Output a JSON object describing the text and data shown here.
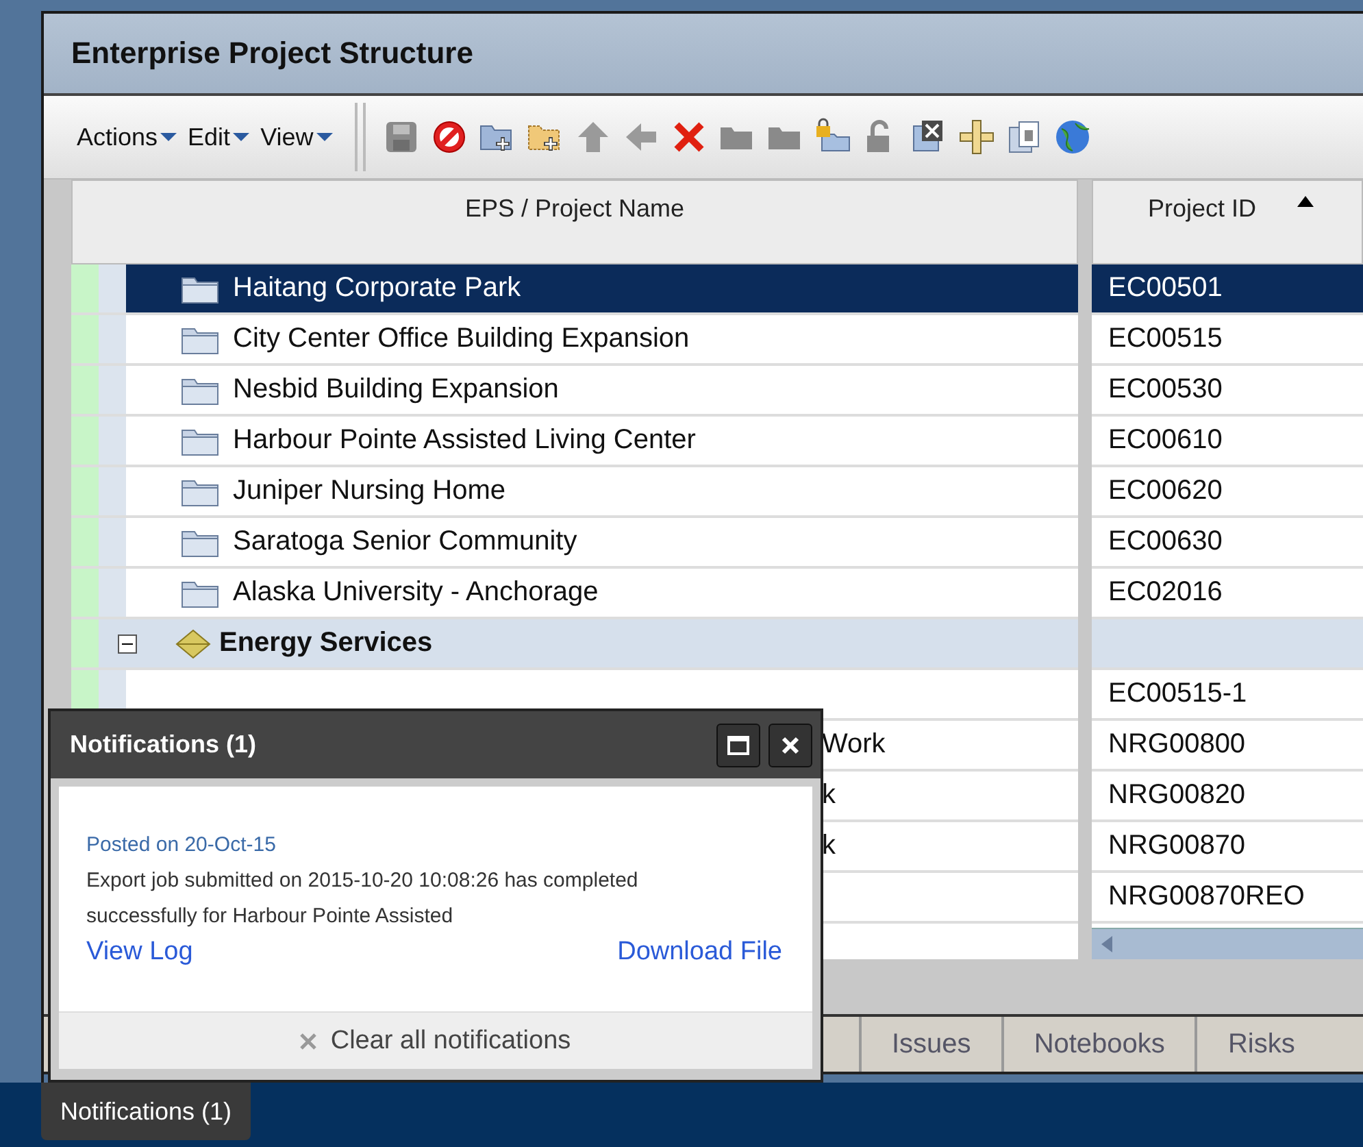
{
  "window": {
    "title": "Enterprise Project Structure"
  },
  "menu": [
    {
      "label": "Actions"
    },
    {
      "label": "Edit"
    },
    {
      "label": "View"
    }
  ],
  "table": {
    "columns": [
      {
        "label": "EPS / Project Name",
        "sorted_ascending": false
      },
      {
        "label": "Project ID",
        "sorted_ascending": true
      }
    ],
    "rows": [
      {
        "kind": "project",
        "name": "Haitang Corporate Park",
        "id": "EC00501",
        "selected": true
      },
      {
        "kind": "project",
        "name": "City Center Office Building Expansion",
        "id": "EC00515",
        "selected": false
      },
      {
        "kind": "project",
        "name": "Nesbid Building Expansion",
        "id": "EC00530",
        "selected": false
      },
      {
        "kind": "project",
        "name": "Harbour Pointe Assisted Living Center",
        "id": "EC00610",
        "selected": false
      },
      {
        "kind": "project",
        "name": "Juniper Nursing Home",
        "id": "EC00620",
        "selected": false
      },
      {
        "kind": "project",
        "name": "Saratoga Senior Community",
        "id": "EC00630",
        "selected": false
      },
      {
        "kind": "project",
        "name": "Alaska University - Anchorage",
        "id": "EC02016",
        "selected": false
      },
      {
        "kind": "eps",
        "name": "Energy Services",
        "expanded": true,
        "selected": false,
        "children": [
          {
            "kind": "covered",
            "id": "EC00515-1",
            "selected": false
          },
          {
            "kind": "covered",
            "name": "Work",
            "id": "NRG00800",
            "selected": false
          },
          {
            "kind": "covered",
            "name": "k",
            "id": "NRG00820",
            "selected": false
          },
          {
            "kind": "covered",
            "name": "k",
            "id": "NRG00870",
            "selected": false
          },
          {
            "kind": "covered",
            "id": "NRG00870REO",
            "selected": false
          }
        ]
      }
    ]
  },
  "tabs": [
    {
      "label": "Issues",
      "selected": false
    },
    {
      "label": "Notebooks",
      "selected": false
    },
    {
      "label": "Risks",
      "selected": false
    }
  ],
  "notifications": {
    "title": "Notifications (1)",
    "posted": "Posted on 20-Oct-15",
    "message": "Export job submitted on 2015-10-20 10:08:26 has completed successfully for Harbour Pointe Assisted",
    "links": [
      "View Log",
      "Download File"
    ],
    "clear": "Clear all notifications"
  },
  "taskbar": {
    "button": "Notifications (1)"
  }
}
